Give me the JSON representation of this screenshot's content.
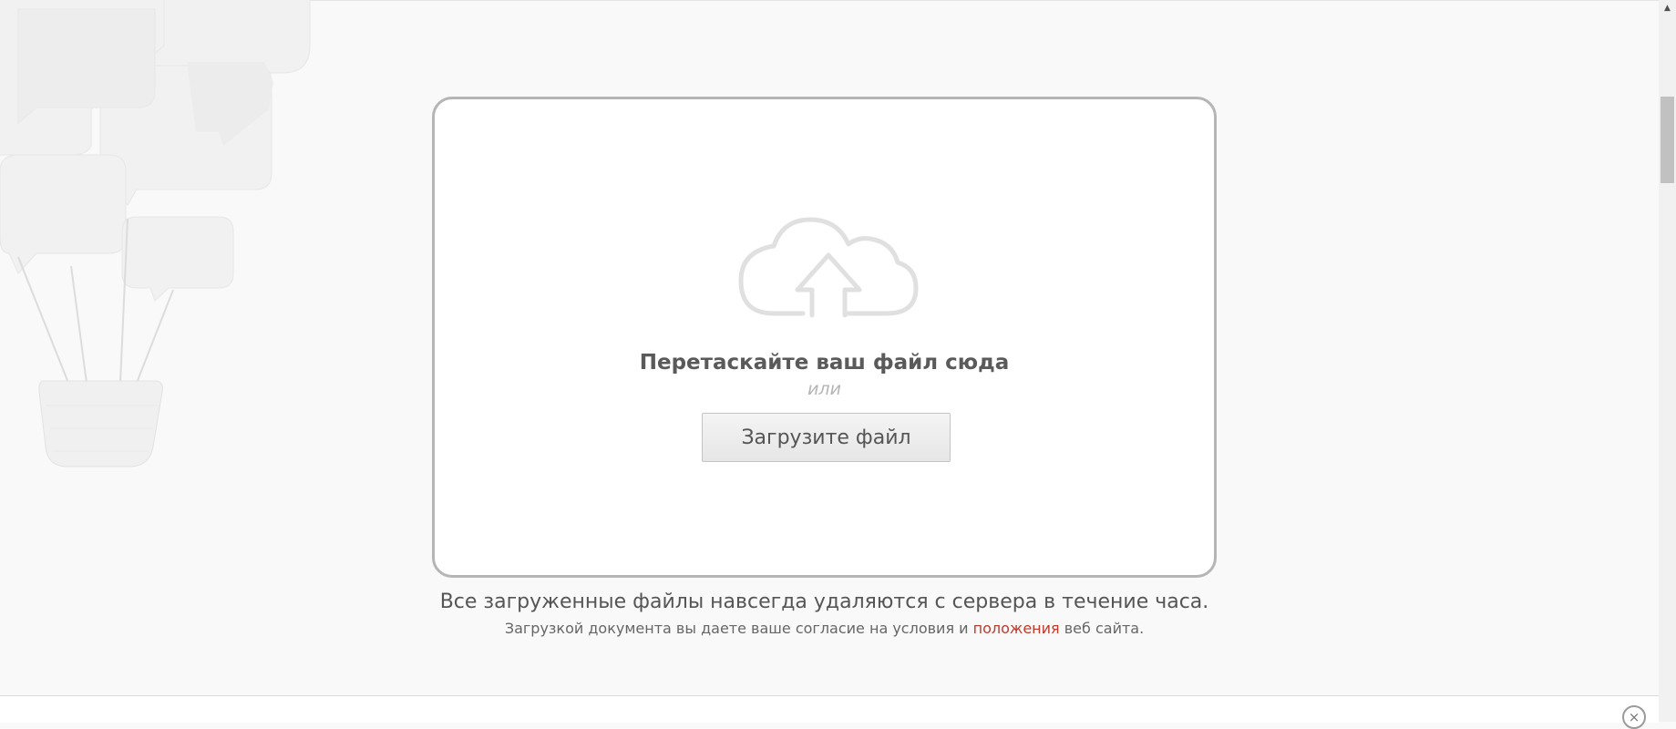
{
  "dropzone": {
    "icon": "cloud-upload-icon",
    "drag_text": "Перетаскайте ваш файл сюда",
    "or_text": "или",
    "upload_button_label": "Загрузите файл"
  },
  "notice": {
    "main_text": "Все загруженные файлы навсегда удаляются с сервера в течение часа.",
    "consent_prefix": "Загрузкой документа вы даете ваше согласие на условия и ",
    "consent_link": "положения",
    "consent_suffix": " веб сайта."
  },
  "bottom_panel": {
    "close_icon": "×"
  },
  "scrollbar": {
    "up_arrow": "▲"
  },
  "colors": {
    "link": "#c0392b",
    "border": "#b5b5b5",
    "background": "#f9f9f9"
  }
}
